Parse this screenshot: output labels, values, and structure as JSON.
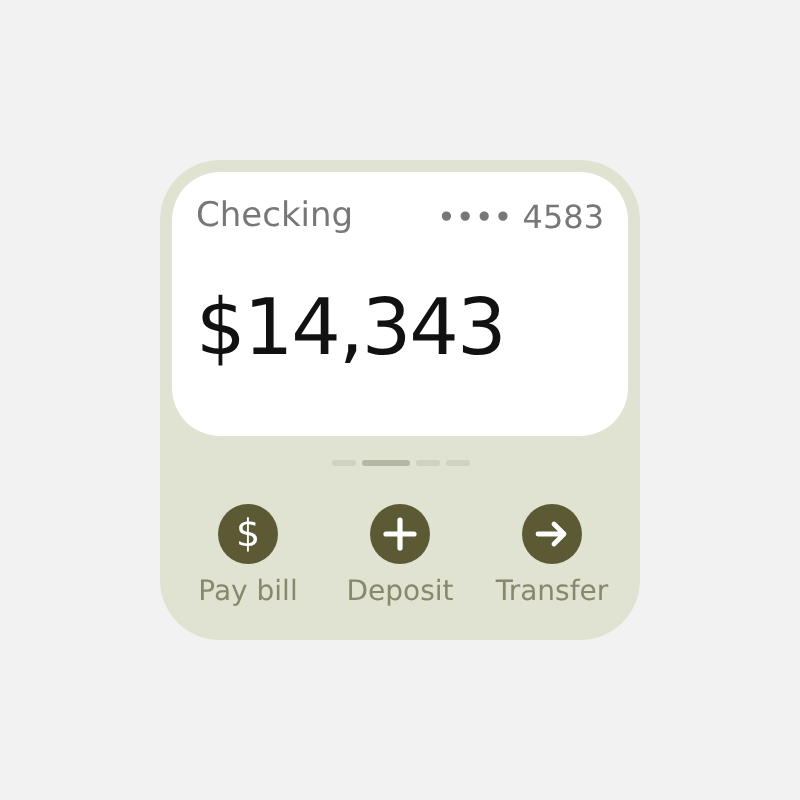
{
  "account": {
    "name": "Checking",
    "number": "•••• 4583",
    "balance": "$14,343"
  },
  "pages": [
    {
      "selected": false
    },
    {
      "selected": true
    },
    {
      "selected": false
    },
    {
      "selected": false
    }
  ],
  "actions": [
    {
      "kind": "glyph",
      "glyph": "$",
      "label": "Pay bill"
    },
    {
      "kind": "plus",
      "label": "Deposit"
    },
    {
      "kind": "arrow",
      "label": "Transfer"
    }
  ]
}
